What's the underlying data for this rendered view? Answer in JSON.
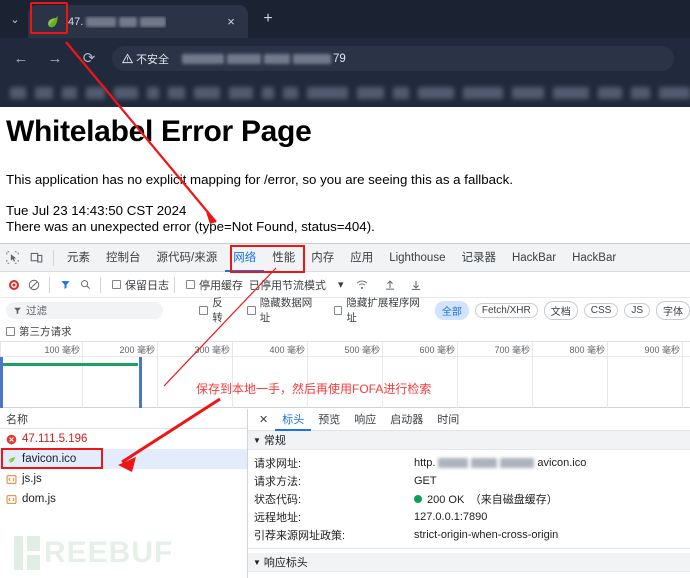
{
  "browser": {
    "tab": {
      "title_prefix": "47.",
      "close_label": "×",
      "new_tab_label": "+",
      "chevron": "⌄",
      "favicon": "spring-leaf-icon"
    },
    "nav": {
      "back": "←",
      "forward": "→",
      "reload": "⟳"
    },
    "omnibox": {
      "security_label": "不安全",
      "security_icon": "warning-triangle-icon",
      "url_suffix": "79"
    }
  },
  "page": {
    "title": "Whitelabel Error Page",
    "line1": "This application has no explicit mapping for /error, so you are seeing this as a fallback.",
    "line2": "Tue Jul 23 14:43:50 CST 2024",
    "line3": "There was an unexpected error (type=Not Found, status=404)."
  },
  "devtools": {
    "tools": {
      "inspect": "inspect-element-icon",
      "device": "device-toolbar-icon"
    },
    "tabs": [
      {
        "label": "元素",
        "active": false
      },
      {
        "label": "控制台",
        "active": false
      },
      {
        "label": "源代码/来源",
        "active": false
      },
      {
        "label": "网络",
        "active": true
      },
      {
        "label": "性能",
        "active": false
      },
      {
        "label": "内存",
        "active": false
      },
      {
        "label": "应用",
        "active": false
      },
      {
        "label": "Lighthouse",
        "active": false
      },
      {
        "label": "记录器",
        "active": false
      },
      {
        "label": "HackBar",
        "active": false
      },
      {
        "label": "HackBar",
        "active": false
      }
    ],
    "toolbar": {
      "record": "record-button",
      "clear": "clear-button",
      "filter_icon": "filter-icon",
      "search_icon": "search-icon",
      "preserve_log": "保留日志",
      "disable_cache": "停用缓存",
      "throttling": "已停用节流模式",
      "dropdown": "▾",
      "wifi_icon": "network-conditions-icon",
      "import_icon": "import-har-icon",
      "export_icon": "export-har-icon"
    },
    "filterbar": {
      "filter_placeholder": "过滤",
      "invert": "反转",
      "hide_data_urls": "隐藏数据网址",
      "hide_ext_urls": "隐藏扩展程序网址",
      "third_party": "第三方请求",
      "chips": [
        {
          "label": "全部",
          "active": true
        },
        {
          "label": "Fetch/XHR",
          "active": false
        },
        {
          "label": "文档",
          "active": false
        },
        {
          "label": "CSS",
          "active": false
        },
        {
          "label": "JS",
          "active": false
        },
        {
          "label": "字体",
          "active": false
        }
      ]
    },
    "overview": {
      "ticks": [
        "100 毫秒",
        "200 毫秒",
        "300 毫秒",
        "400 毫秒",
        "500 毫秒",
        "600 毫秒",
        "700 毫秒",
        "800 毫秒",
        "900 毫秒"
      ],
      "annotation": "保存到本地一手，然后再使用FOFA进行检索"
    },
    "requests": {
      "header": "名称",
      "rows": [
        {
          "name": "47.111.5.196",
          "icon": "error-circle-icon",
          "state": "error"
        },
        {
          "name": "favicon.ico",
          "icon": "spring-leaf-icon",
          "state": "selected"
        },
        {
          "name": "js.js",
          "icon": "script-file-icon",
          "state": "normal"
        },
        {
          "name": "dom.js",
          "icon": "script-file-icon",
          "state": "normal"
        }
      ]
    },
    "detail": {
      "close": "✕",
      "tabs": [
        {
          "label": "标头",
          "active": true
        },
        {
          "label": "预览",
          "active": false
        },
        {
          "label": "响应",
          "active": false
        },
        {
          "label": "启动器",
          "active": false
        },
        {
          "label": "时间",
          "active": false
        }
      ],
      "general_section": "常规",
      "response_section": "响应标头",
      "fields": [
        {
          "key": "请求网址:",
          "value": "http.",
          "value_suffix": "avicon.ico",
          "blurred": true
        },
        {
          "key": "请求方法:",
          "value": "GET",
          "blurred": false
        },
        {
          "key": "状态代码:",
          "value": "200 OK　（来自磁盘缓存）",
          "status": true,
          "blurred": false
        },
        {
          "key": "远程地址:",
          "value": "127.0.0.1:7890",
          "blurred": false
        },
        {
          "key": "引荐来源网址政策:",
          "value": "strict-origin-when-cross-origin",
          "blurred": false
        }
      ]
    }
  },
  "watermark": {
    "text": "REEBUF"
  },
  "colors": {
    "accent": "#1a73e8",
    "annotation": "#f01515",
    "status_ok": "#0f9d58",
    "error": "#c5221f",
    "chrome_dark": "#1b2232"
  }
}
